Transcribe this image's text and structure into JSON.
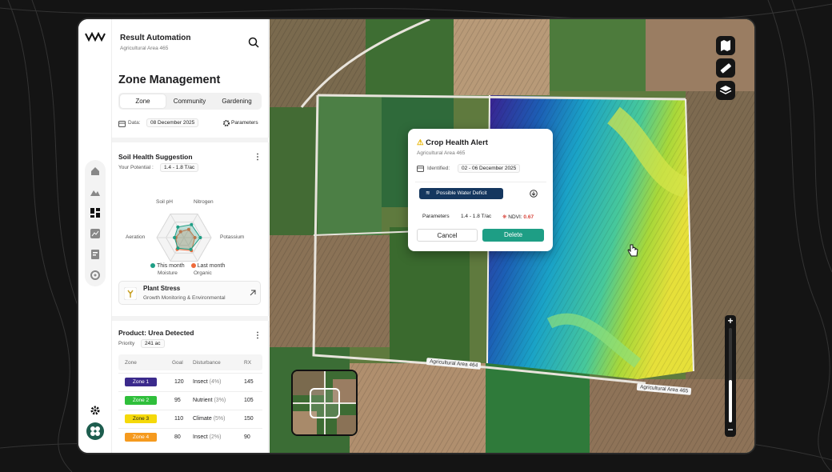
{
  "app": {
    "title": "Result Automation",
    "subtitle": "Agricultural Area 465"
  },
  "page_title": "Zone Management",
  "tabs": [
    {
      "label": "Zone"
    },
    {
      "label": "Community"
    },
    {
      "label": "Gardening"
    }
  ],
  "date_row": {
    "label": "Data:",
    "value": "08 December 2025",
    "params": "Parameters"
  },
  "soil": {
    "title": "Soil Health Suggestion",
    "potential_label": "Your Potential :",
    "potential_value": "1.4 - 1.8 T/ac",
    "axes": [
      "Soil pH",
      "Nitrogen",
      "Potassium",
      "Organic",
      "Moisture",
      "Aeration"
    ],
    "legend": [
      {
        "name": "This month",
        "color": "#1e9e85"
      },
      {
        "name": "Last month",
        "color": "#ee6a3a"
      }
    ],
    "this_month": [
      0.45,
      0.55,
      0.6,
      0.5,
      0.45,
      0.35
    ],
    "last_month": [
      0.25,
      0.35,
      0.4,
      0.55,
      0.5,
      0.3
    ]
  },
  "stress": {
    "title": "Plant Stress",
    "subtitle": "Growth Monitoring & Environmental"
  },
  "product": {
    "title": "Product: Urea Detected",
    "priority_label": "Priority",
    "priority_value": "241 ac",
    "headers": [
      "Zone",
      "Goal",
      "Disturbance",
      "RX"
    ],
    "rows": [
      {
        "zone": "Zone 1",
        "color": "#3b2a8c",
        "goal": "120",
        "dist": "Insect",
        "pct": "(4%)",
        "rx": "145"
      },
      {
        "zone": "Zone 2",
        "color": "#2fbf3b",
        "goal": "95",
        "dist": "Nutrient",
        "pct": "(3%)",
        "rx": "105"
      },
      {
        "zone": "Zone 3",
        "color": "#f5d90a",
        "goal": "110",
        "dist": "Climate",
        "pct": "(5%)",
        "rx": "150"
      },
      {
        "zone": "Zone 4",
        "color": "#f59a1e",
        "goal": "80",
        "dist": "Insect",
        "pct": "(2%)",
        "rx": "90"
      }
    ]
  },
  "alert": {
    "title": "Crop Health Alert",
    "subtitle": "Agricultural Area 465",
    "identified_label": "Identified:",
    "identified_value": "02 - 06 December 2025",
    "deficit": "Possible Water Deficit",
    "params_label": "Parameters",
    "params_value": "1.4 - 1.8 T/ac",
    "ndvi_label": "NDVI:",
    "ndvi_value": "0.67",
    "cancel": "Cancel",
    "delete": "Delete"
  },
  "map_labels": {
    "area464": "Agricultural Area 464",
    "area465": "Agricultural Area 465"
  },
  "zoom": {
    "plus": "+",
    "minus": "−",
    "level": 0.45
  }
}
